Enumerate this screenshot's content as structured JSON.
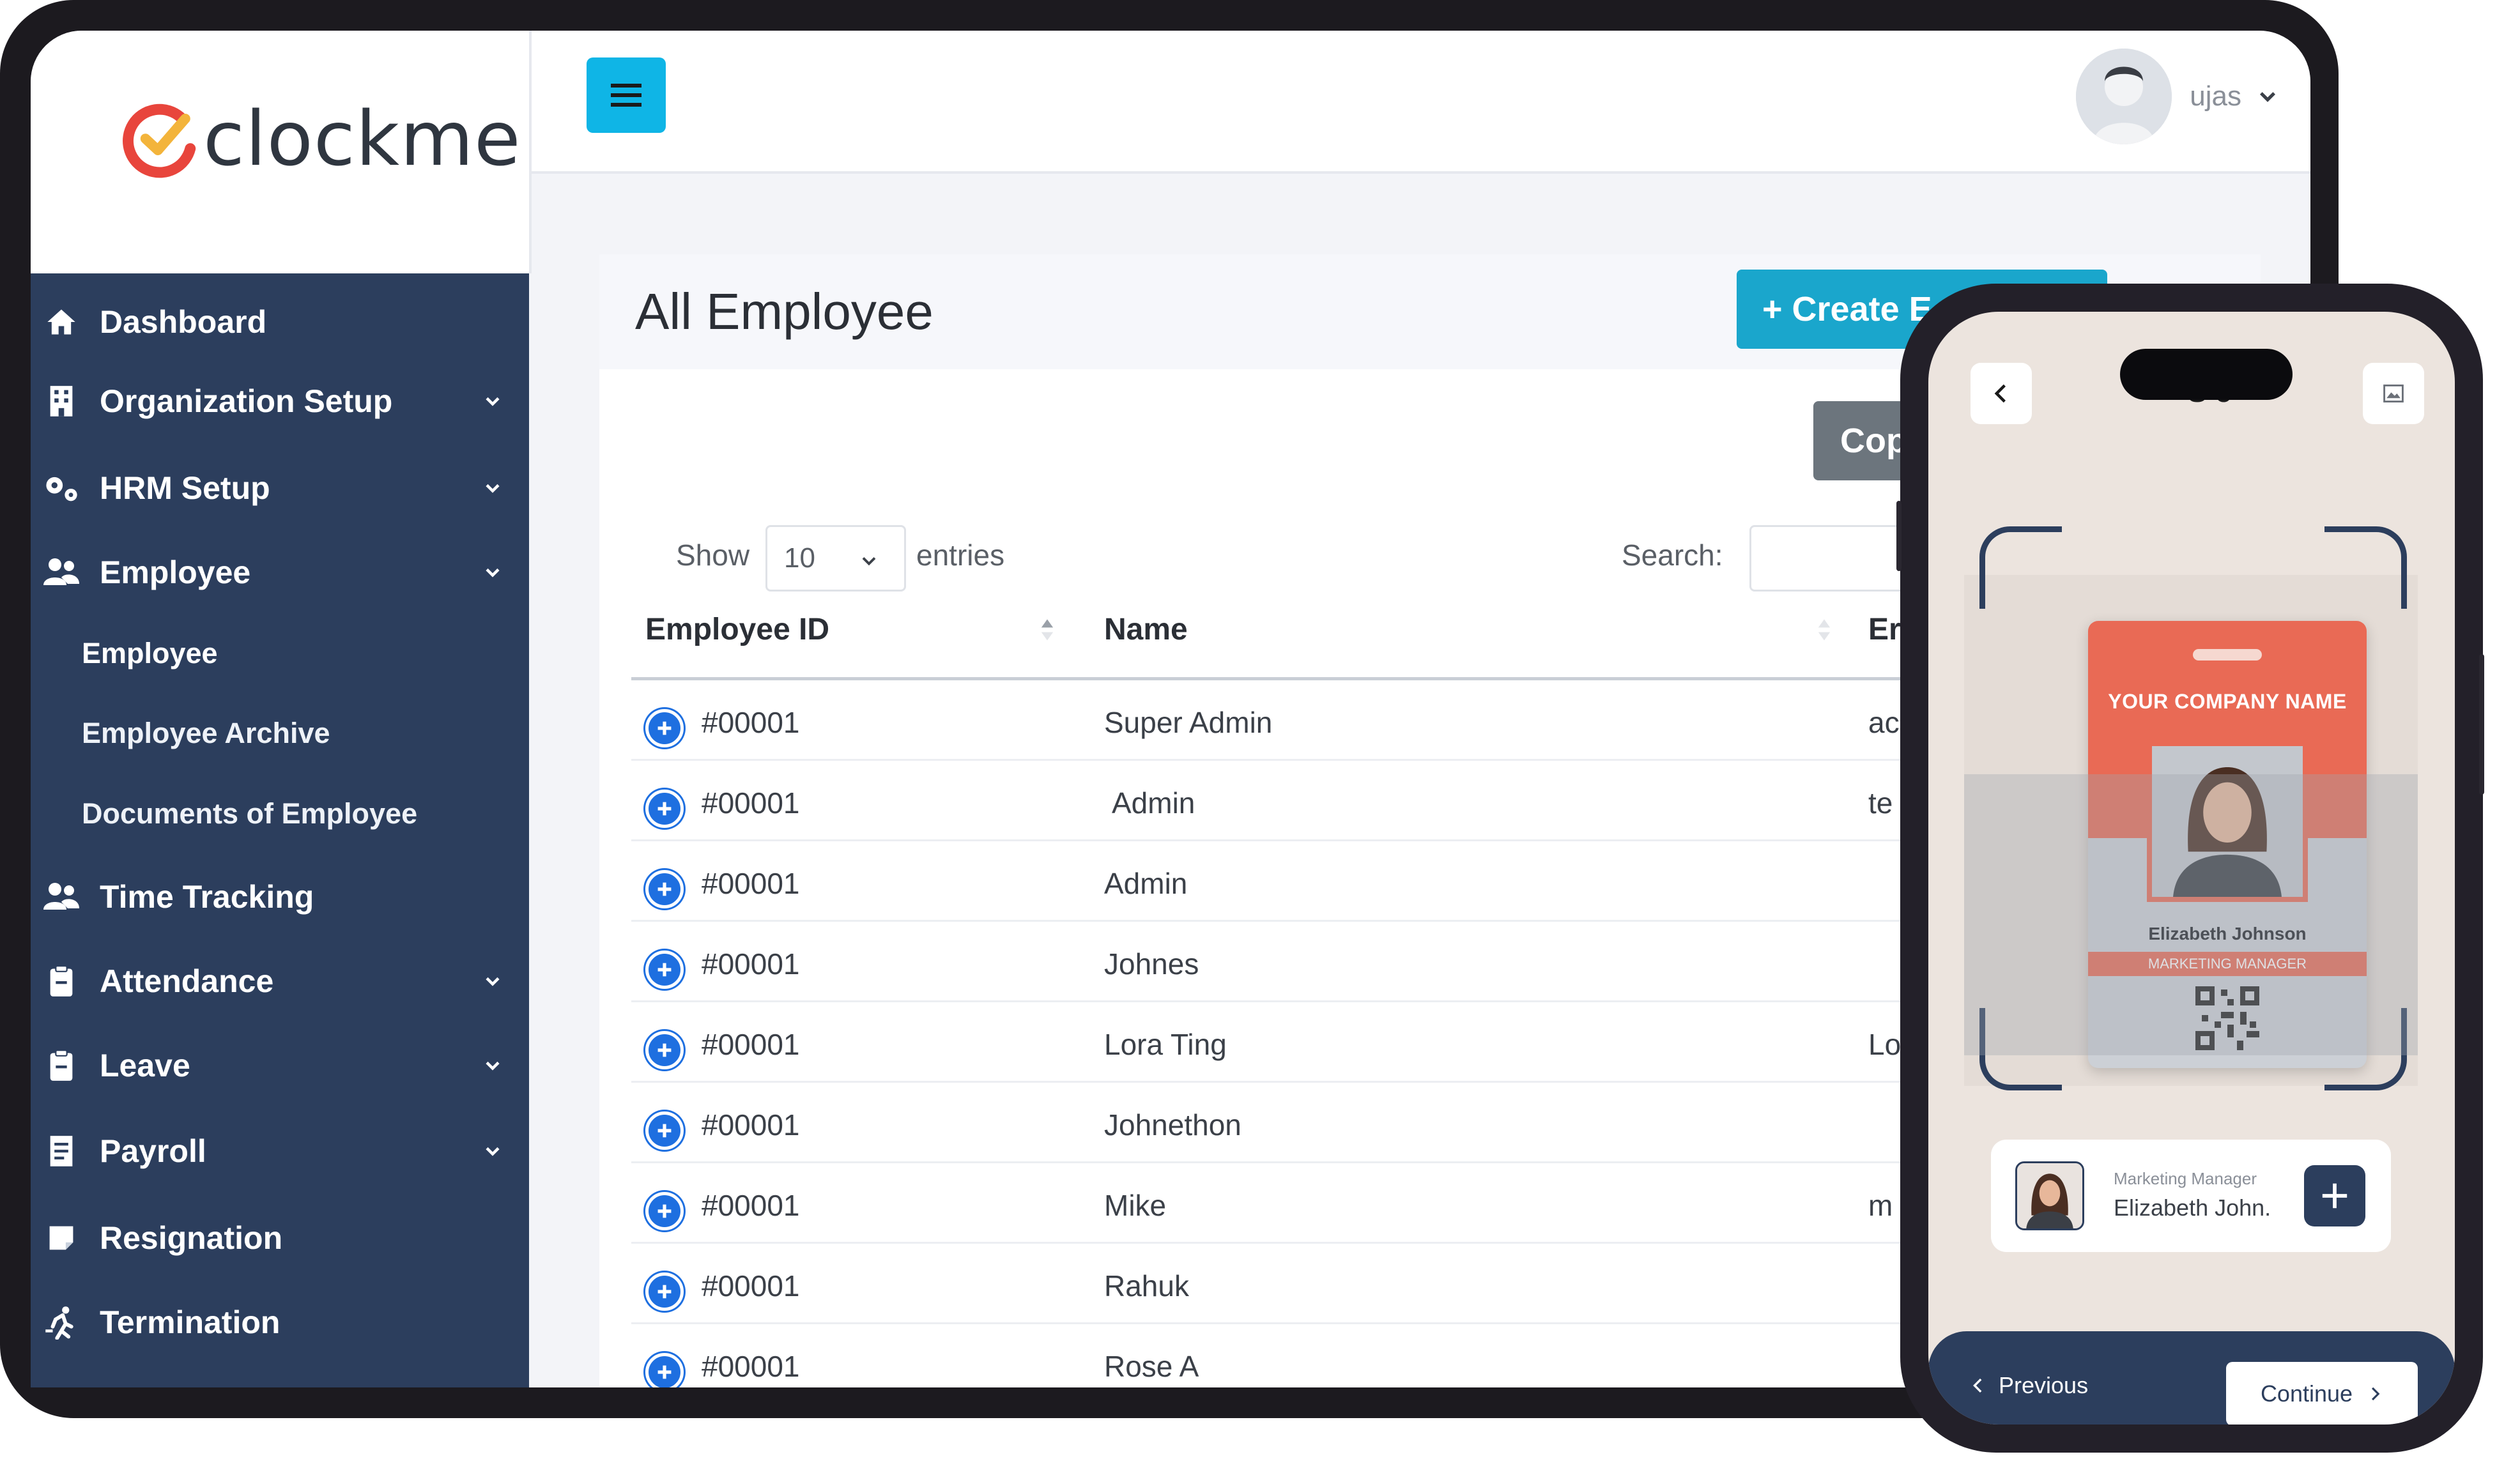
{
  "brand": {
    "name": "clockme"
  },
  "sidebar": {
    "items": [
      {
        "label": "Dashboard",
        "icon": "home-icon",
        "has_caret": false
      },
      {
        "label": "Organization Setup",
        "icon": "building-icon",
        "has_caret": true
      },
      {
        "label": "HRM Setup",
        "icon": "cogs-icon",
        "has_caret": true
      },
      {
        "label": "Employee",
        "icon": "users-icon",
        "has_caret": true
      },
      {
        "label": "Time Tracking",
        "icon": "users-icon",
        "has_caret": false
      },
      {
        "label": "Attendance",
        "icon": "clipboard-icon",
        "has_caret": true
      },
      {
        "label": "Leave",
        "icon": "clipboard-icon",
        "has_caret": true
      },
      {
        "label": "Payroll",
        "icon": "receipt-icon",
        "has_caret": true
      },
      {
        "label": "Resignation",
        "icon": "note-icon",
        "has_caret": false
      },
      {
        "label": "Termination",
        "icon": "running-icon",
        "has_caret": false
      }
    ],
    "employee_sub": [
      "Employee",
      "Employee Archive",
      "Documents of Employee"
    ]
  },
  "topbar": {
    "menu_icon": "hamburger-icon",
    "user_name": "ujas"
  },
  "page": {
    "title": "All Employee",
    "create_button": "+ Create E",
    "copy_button": "Cop",
    "show_label": "Show",
    "page_length": "10",
    "entries_label": "entries",
    "search_label": "Search:",
    "search_value": ""
  },
  "table": {
    "columns": [
      "Employee ID",
      "Name",
      "Er"
    ],
    "rows": [
      {
        "id": "#00001",
        "name": "Super Admin",
        "email": "ac"
      },
      {
        "id": "#00001",
        "name": "Admin",
        "email": "te"
      },
      {
        "id": "#00001",
        "name": "Admin",
        "email": ""
      },
      {
        "id": "#00001",
        "name": "Johnes",
        "email": ""
      },
      {
        "id": "#00001",
        "name": "Lora Ting",
        "email": "Lo"
      },
      {
        "id": "#00001",
        "name": "Johnethon",
        "email": ""
      },
      {
        "id": "#00001",
        "name": "Mike",
        "email": "m"
      },
      {
        "id": "#00001",
        "name": "Rahuk",
        "email": ""
      },
      {
        "id": "#00001",
        "name": "Rose A",
        "email": ""
      }
    ]
  },
  "phone": {
    "title": "S      e",
    "id_card": {
      "company": "YOUR COMPANY NAME",
      "name": "Elizabeth Johnson",
      "role": "MARKETING MANAGER"
    },
    "person_card": {
      "role": "Marketing Manager",
      "name": "Elizabeth John."
    },
    "previous_label": "Previous",
    "continue_label": "Continue"
  },
  "colors": {
    "sidebar": "#2c3e5d",
    "accent": "#0fb5e6",
    "create": "#1aa6cc",
    "card_red": "#e96a55"
  }
}
